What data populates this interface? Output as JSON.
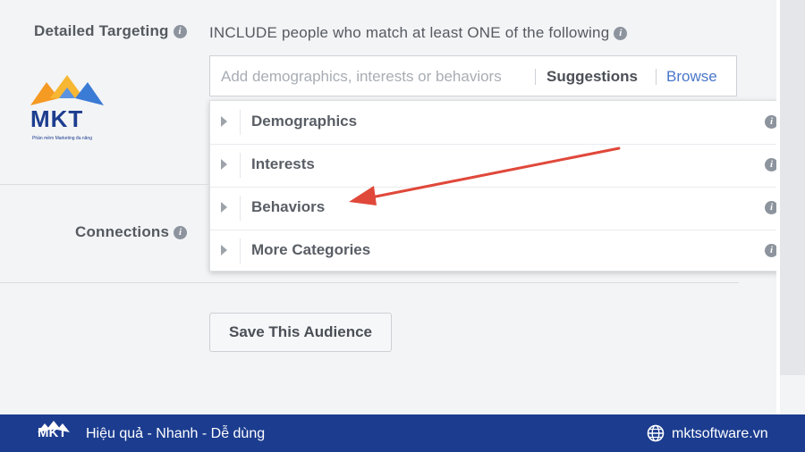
{
  "targeting": {
    "label": "Detailed Targeting",
    "include_text": "INCLUDE people who match at least ONE of the following",
    "search_placeholder": "Add demographics, interests or behaviors",
    "suggestions_label": "Suggestions",
    "browse_label": "Browse"
  },
  "dropdown": {
    "items": [
      {
        "label": "Demographics"
      },
      {
        "label": "Interests"
      },
      {
        "label": "Behaviors"
      },
      {
        "label": "More Categories"
      }
    ]
  },
  "connections": {
    "label": "Connections"
  },
  "save_button": {
    "label": "Save This Audience"
  },
  "logo": {
    "text": "MKT",
    "subtitle": "Phần mềm Marketing đa năng"
  },
  "footer": {
    "tagline": "Hiệu quả - Nhanh - Dễ dùng",
    "website": "mktsoftware.vn",
    "logo_text": "MKT"
  },
  "colors": {
    "accent_link": "#4a76c9",
    "footer_bg": "#1b3c8f",
    "arrow": "#e0483a",
    "logo_orange": "#f59a23",
    "logo_blue": "#3a7bd5"
  }
}
